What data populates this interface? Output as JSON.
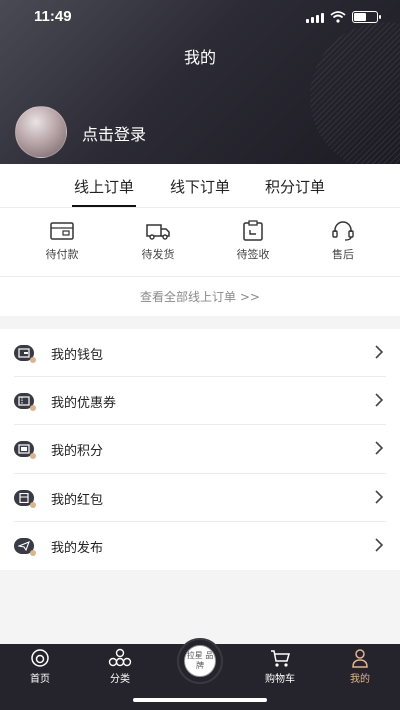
{
  "status_bar": {
    "time": "11:49",
    "icons": [
      "signal-icon",
      "wifi-icon",
      "battery-icon"
    ],
    "battery_level": 0.5
  },
  "header": {
    "title": "我的",
    "login_text": "点击登录"
  },
  "order_tabs": {
    "tabs": [
      {
        "label": "线上订单",
        "active": true
      },
      {
        "label": "线下订单",
        "active": false
      },
      {
        "label": "积分订单",
        "active": false
      }
    ],
    "statuses": [
      {
        "label": "待付款",
        "icon": "card-icon"
      },
      {
        "label": "待发货",
        "icon": "truck-icon"
      },
      {
        "label": "待签收",
        "icon": "clipboard-icon"
      },
      {
        "label": "售后",
        "icon": "headset-icon"
      }
    ],
    "view_all": "查看全部线上订单 >>"
  },
  "menu": {
    "items": [
      {
        "label": "我的钱包",
        "icon": "wallet-icon"
      },
      {
        "label": "我的优惠券",
        "icon": "coupon-icon"
      },
      {
        "label": "我的积分",
        "icon": "points-icon"
      },
      {
        "label": "我的红包",
        "icon": "red-packet-icon"
      },
      {
        "label": "我的发布",
        "icon": "send-icon"
      }
    ]
  },
  "bottom_nav": {
    "items": [
      {
        "label": "首页",
        "icon": "home-icon",
        "active": false
      },
      {
        "label": "分类",
        "icon": "category-icon",
        "active": false
      },
      {
        "label": "",
        "icon": "brand-logo-icon",
        "active": false
      },
      {
        "label": "购物车",
        "icon": "cart-icon",
        "active": false
      },
      {
        "label": "我的",
        "icon": "person-icon",
        "active": true
      }
    ],
    "center_logo_text": "拉星 品牌"
  },
  "colors": {
    "header_dark": "#1c1b24",
    "nav_bg": "#25242c",
    "accent_gold": "#e2b48b"
  }
}
